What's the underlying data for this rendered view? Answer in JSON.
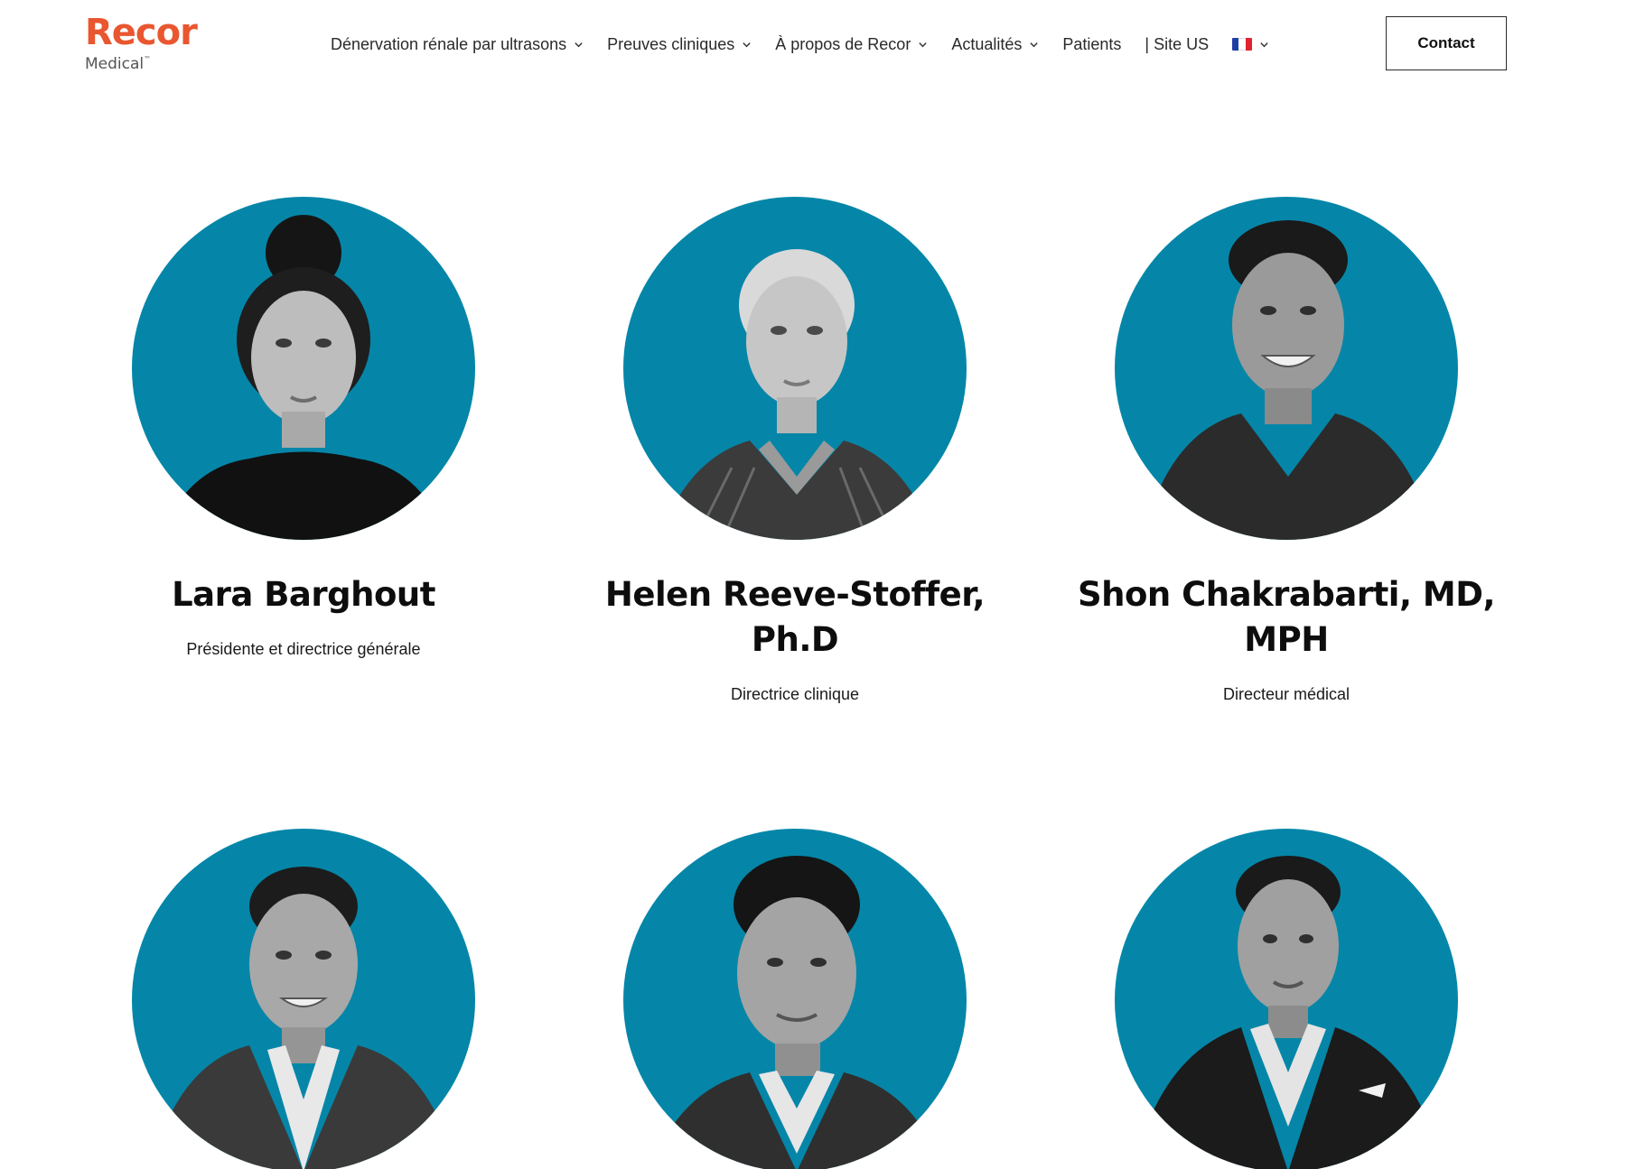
{
  "brand": {
    "name": "Recor",
    "sub": "Medical",
    "tm": "™",
    "primary_color": "#e9562f",
    "sub_color": "#555555"
  },
  "nav": {
    "items": [
      {
        "label": "Dénervation rénale par ultrasons",
        "has_dropdown": true
      },
      {
        "label": "Preuves cliniques",
        "has_dropdown": true
      },
      {
        "label": "À propos de Recor",
        "has_dropdown": true
      },
      {
        "label": "Actualités",
        "has_dropdown": true
      },
      {
        "label": "Patients",
        "has_dropdown": false
      },
      {
        "label": "| Site US",
        "has_dropdown": false
      }
    ],
    "language": {
      "icon": "flag-france-icon",
      "colors": [
        "#1f3fa6",
        "#ffffff",
        "#e0242f"
      ]
    },
    "contact_label": "Contact"
  },
  "team": {
    "avatar_bg_color": "#0586a8",
    "members": [
      {
        "name": "Lara Barghout",
        "role": "Présidente et directrice générale",
        "portrait": "portrait-lara-barghout"
      },
      {
        "name": "Helen Reeve-Stoffer, Ph.D",
        "role": "Directrice clinique",
        "portrait": "portrait-helen-reeve-stoffer"
      },
      {
        "name": "Shon Chakrabarti, MD, MPH",
        "role": "Directeur médical",
        "portrait": "portrait-shon-chakrabarti"
      },
      {
        "name": "",
        "role": "",
        "portrait": "portrait-team-member-4"
      },
      {
        "name": "",
        "role": "",
        "portrait": "portrait-team-member-5"
      },
      {
        "name": "",
        "role": "",
        "portrait": "portrait-team-member-6"
      }
    ]
  }
}
